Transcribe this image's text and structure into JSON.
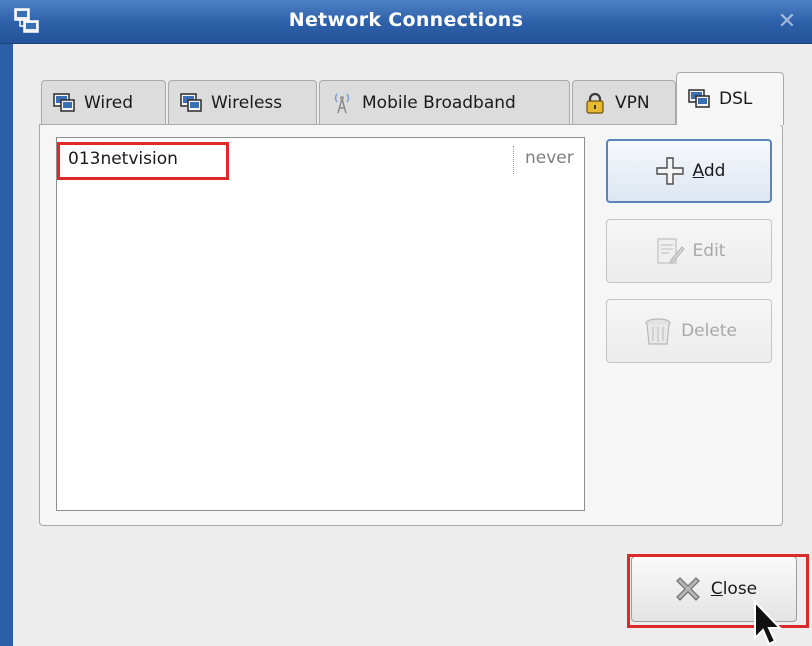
{
  "window": {
    "title": "Network Connections",
    "title_close": "✕"
  },
  "tabs": [
    {
      "label": "Wired",
      "icon": "network-icon"
    },
    {
      "label": "Wireless",
      "icon": "network-icon"
    },
    {
      "label": "Mobile Broadband",
      "icon": "antenna-icon"
    },
    {
      "label": "VPN",
      "icon": "lock-icon"
    },
    {
      "label": "DSL",
      "icon": "network-icon",
      "active": true
    }
  ],
  "connections": [
    {
      "name": "013netvision",
      "last_used": "never"
    }
  ],
  "buttons": {
    "add": {
      "mnemonic": "A",
      "rest": "dd"
    },
    "edit": {
      "label": "Edit"
    },
    "delete": {
      "label": "Delete"
    },
    "close": {
      "mnemonic": "C",
      "rest": "lose"
    }
  },
  "colors": {
    "titlebar": "#2d5fa8",
    "highlight": "#dc2a2a"
  }
}
